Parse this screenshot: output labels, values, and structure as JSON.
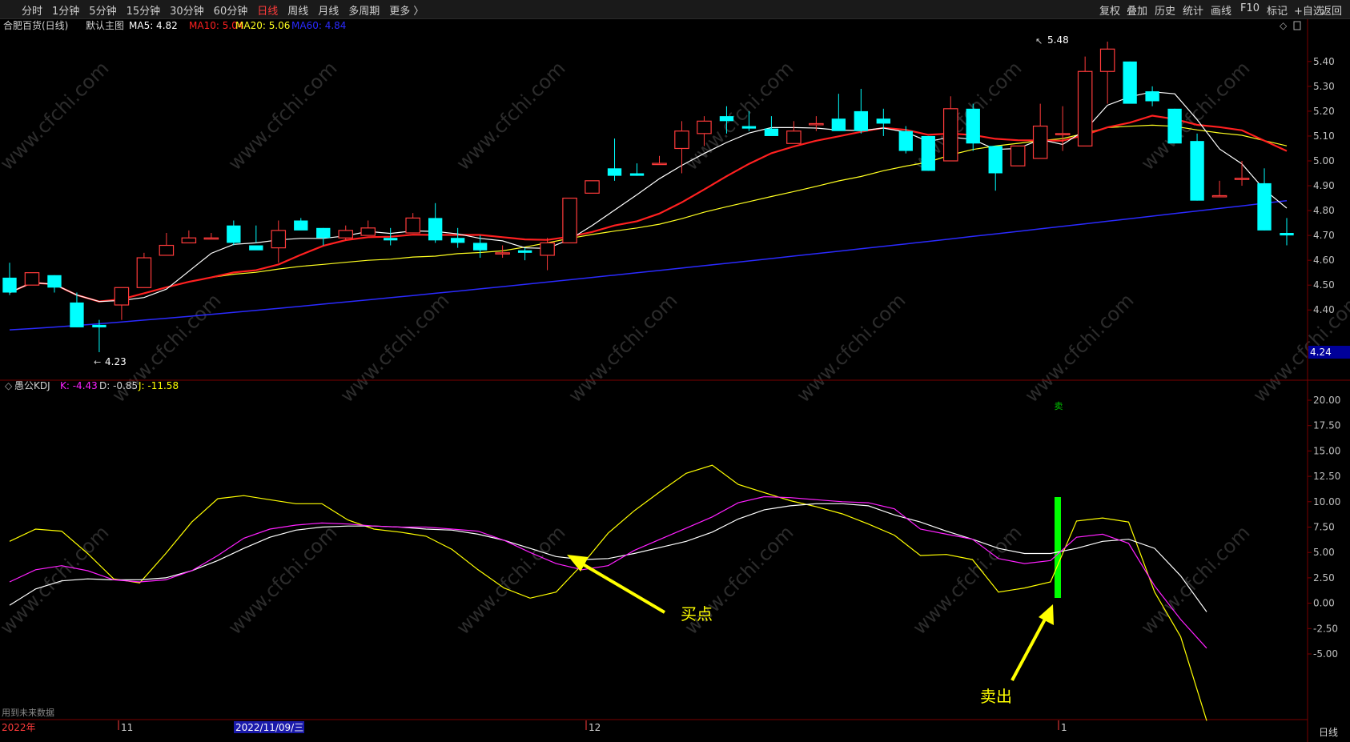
{
  "toolbar": {
    "left": [
      "分时",
      "1分钟",
      "5分钟",
      "15分钟",
      "30分钟",
      "60分钟",
      "日线",
      "周线",
      "月线",
      "多周期",
      "更多 〉"
    ],
    "active": "日线",
    "right": [
      "复权",
      "叠加",
      "历史",
      "统计",
      "画线",
      "F10",
      "标记",
      "+自选",
      "返回"
    ]
  },
  "main_chart": {
    "title": "合肥百货(日线)",
    "template": "默认主图",
    "ma": [
      {
        "label": "MA5: 4.82",
        "color": "#ffffff"
      },
      {
        "label": "MA10: 5.04",
        "color": "#ff2020"
      },
      {
        "label": "MA20: 5.06",
        "color": "#ffff20"
      },
      {
        "label": "MA60: 4.84",
        "color": "#2a2aff"
      }
    ],
    "high_label": "5.48",
    "low_label": "4.23",
    "current_price": "4.24",
    "y_ticks": [
      "5.40",
      "5.30",
      "5.20",
      "5.10",
      "5.00",
      "4.90",
      "4.80",
      "4.70",
      "4.60",
      "4.50",
      "4.40"
    ]
  },
  "indicator": {
    "name": "愚公KDJ",
    "k": "K: -4.43",
    "d": "D: -0.85",
    "j": "J: -11.58",
    "sell_marker": "卖",
    "y_ticks": [
      "20.00",
      "17.50",
      "15.00",
      "12.50",
      "10.00",
      "7.50",
      "5.00",
      "2.50",
      "0.00",
      "-2.50",
      "-5.00"
    ]
  },
  "annotations": {
    "buy": "买点",
    "sell": "卖出"
  },
  "footer_note": "用到未来数据",
  "period_label": "日线",
  "x_axis": {
    "labels": [
      "2022年",
      "11",
      "2022/11/09/三",
      "12",
      "1"
    ]
  },
  "watermark": "www.cfchi.com",
  "colors": {
    "up": "#ff3b3b",
    "down": "#00ffff",
    "ma5": "#ffffff",
    "ma10": "#ff2020",
    "ma20": "#ffff20",
    "ma60": "#2a2aff",
    "k": "#ff20ff",
    "d": "#ffffff",
    "j": "#ffff00",
    "sell_bar": "#00ff00"
  },
  "chart_data": [
    {
      "type": "candlestick",
      "title": "合肥百货(日线)",
      "ylim": [
        4.24,
        5.48
      ],
      "ohlc": [
        [
          4.53,
          4.59,
          4.46,
          4.47
        ],
        [
          4.5,
          4.55,
          4.5,
          4.55
        ],
        [
          4.54,
          4.54,
          4.47,
          4.49
        ],
        [
          4.43,
          4.47,
          4.33,
          4.33
        ],
        [
          4.34,
          4.36,
          4.23,
          4.33
        ],
        [
          4.42,
          4.49,
          4.36,
          4.49
        ],
        [
          4.49,
          4.63,
          4.49,
          4.61
        ],
        [
          4.62,
          4.71,
          4.62,
          4.66
        ],
        [
          4.67,
          4.72,
          4.67,
          4.69
        ],
        [
          4.69,
          4.69,
          4.71,
          4.69
        ],
        [
          4.74,
          4.76,
          4.66,
          4.67
        ],
        [
          4.66,
          4.74,
          4.67,
          4.64
        ],
        [
          4.65,
          4.76,
          4.59,
          4.72
        ],
        [
          4.76,
          4.77,
          4.74,
          4.72
        ],
        [
          4.73,
          4.73,
          4.66,
          4.69
        ],
        [
          4.69,
          4.74,
          4.68,
          4.72
        ],
        [
          4.7,
          4.76,
          4.7,
          4.73
        ],
        [
          4.69,
          4.73,
          4.66,
          4.68
        ],
        [
          4.71,
          4.79,
          4.71,
          4.77
        ],
        [
          4.77,
          4.83,
          4.67,
          4.68
        ],
        [
          4.69,
          4.73,
          4.65,
          4.67
        ],
        [
          4.67,
          4.7,
          4.61,
          4.64
        ],
        [
          4.63,
          4.66,
          4.61,
          4.63
        ],
        [
          4.64,
          4.65,
          4.6,
          4.63
        ],
        [
          4.62,
          4.69,
          4.56,
          4.67
        ],
        [
          4.67,
          4.85,
          4.67,
          4.85
        ],
        [
          4.87,
          4.92,
          4.87,
          4.92
        ],
        [
          4.97,
          5.09,
          4.92,
          4.94
        ],
        [
          4.95,
          4.99,
          4.94,
          4.94
        ],
        [
          4.99,
          5.02,
          4.99,
          4.99
        ],
        [
          5.05,
          5.16,
          4.95,
          5.12
        ],
        [
          5.11,
          5.18,
          5.06,
          5.16
        ],
        [
          5.18,
          5.22,
          5.11,
          5.16
        ],
        [
          5.14,
          5.2,
          5.12,
          5.13
        ],
        [
          5.13,
          5.18,
          5.12,
          5.1
        ],
        [
          5.07,
          5.16,
          5.07,
          5.12
        ],
        [
          5.15,
          5.18,
          5.12,
          5.15
        ],
        [
          5.17,
          5.27,
          5.17,
          5.12
        ],
        [
          5.2,
          5.29,
          5.11,
          5.12
        ],
        [
          5.17,
          5.21,
          5.1,
          5.15
        ],
        [
          5.12,
          5.14,
          5.03,
          5.04
        ],
        [
          5.1,
          5.1,
          4.96,
          4.96
        ],
        [
          5.0,
          5.26,
          5.0,
          5.21
        ],
        [
          5.21,
          5.23,
          5.04,
          5.07
        ],
        [
          5.06,
          5.06,
          4.88,
          4.95
        ],
        [
          4.98,
          5.06,
          4.98,
          5.06
        ],
        [
          5.01,
          5.23,
          5.01,
          5.14
        ],
        [
          5.11,
          5.22,
          5.04,
          5.11
        ],
        [
          5.06,
          5.42,
          5.06,
          5.36
        ],
        [
          5.36,
          5.48,
          5.23,
          5.45
        ],
        [
          5.4,
          5.4,
          5.27,
          5.23
        ],
        [
          5.28,
          5.3,
          5.22,
          5.24
        ],
        [
          5.21,
          5.21,
          5.07,
          5.07
        ],
        [
          5.08,
          5.11,
          4.84,
          4.84
        ],
        [
          4.86,
          4.92,
          4.86,
          4.86
        ],
        [
          4.93,
          5.0,
          4.9,
          4.93
        ],
        [
          4.91,
          4.97,
          4.72,
          4.72
        ],
        [
          4.71,
          4.77,
          4.66,
          4.7
        ]
      ]
    },
    {
      "type": "line",
      "title": "愚公KDJ",
      "ylim": [
        -5,
        20
      ],
      "series": [
        {
          "name": "K",
          "values": [
            2.1,
            3.3,
            3.7,
            3.2,
            2.3,
            2.1,
            2.3,
            3.2,
            4.7,
            6.4,
            7.3,
            7.7,
            7.9,
            7.8,
            7.6,
            7.5,
            7.5,
            7.3,
            7.1,
            6.2,
            5.0,
            3.9,
            3.3,
            3.7,
            5.2,
            6.3,
            7.4,
            8.5,
            9.9,
            10.5,
            10.4,
            10.2,
            10.0,
            9.9,
            9.3,
            7.3,
            6.8,
            6.3,
            4.4,
            3.9,
            4.2,
            6.5,
            6.8,
            5.9,
            1.7,
            -1.6,
            -4.43
          ]
        },
        {
          "name": "D",
          "values": [
            -0.2,
            1.4,
            2.2,
            2.4,
            2.3,
            2.3,
            2.5,
            3.2,
            4.2,
            5.4,
            6.5,
            7.2,
            7.5,
            7.6,
            7.6,
            7.5,
            7.3,
            7.2,
            6.8,
            6.2,
            5.4,
            4.6,
            4.3,
            4.4,
            4.9,
            5.5,
            6.1,
            7.0,
            8.3,
            9.2,
            9.6,
            9.8,
            9.8,
            9.6,
            8.7,
            8.0,
            7.1,
            6.3,
            5.4,
            4.9,
            4.9,
            5.4,
            6.1,
            6.3,
            5.4,
            2.7,
            -0.85
          ]
        },
        {
          "name": "J",
          "values": [
            6.1,
            7.3,
            7.1,
            4.9,
            2.4,
            2.0,
            4.9,
            8.0,
            10.3,
            10.6,
            10.2,
            9.8,
            9.8,
            8.2,
            7.3,
            7.0,
            6.6,
            5.3,
            3.3,
            1.5,
            0.5,
            1.1,
            3.8,
            6.9,
            9.1,
            11.0,
            12.8,
            13.6,
            11.7,
            10.9,
            10.1,
            9.5,
            8.8,
            7.8,
            6.7,
            4.7,
            4.8,
            4.3,
            1.1,
            1.5,
            2.1,
            8.1,
            8.4,
            8.0,
            1.1,
            -3.3,
            -11.58
          ]
        }
      ]
    }
  ]
}
